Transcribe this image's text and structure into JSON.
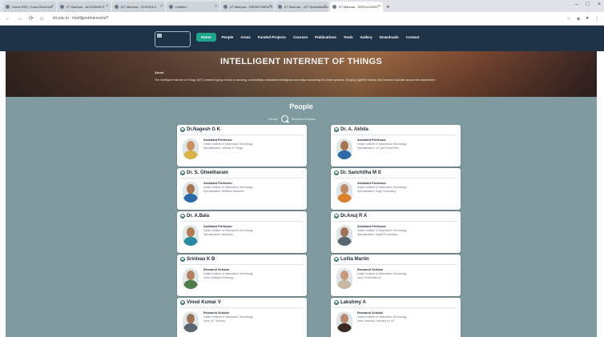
{
  "browser": {
    "tabs": [
      {
        "title": "Home EEE | Sona Electrical",
        "active": false
      },
      {
        "title": "IIT Madurai - ACADEMICS",
        "active": false
      },
      {
        "title": "IIIT Madurai - SCHOOLS",
        "active": false
      },
      {
        "title": "Untitled",
        "active": false
      },
      {
        "title": "IIT Madurai - DEPARTMENTS",
        "active": false
      },
      {
        "title": "IIT Madurai - IOT Specialisation",
        "active": false
      },
      {
        "title": "IIT Madurai - INTELLIGENT",
        "active": true
      }
    ],
    "url": "iiit.edu.in - intelligentInternetIoT",
    "controls": {
      "minimize": "–",
      "maximize": "□",
      "close": "×",
      "newtab": "+"
    },
    "nav": {
      "back": "←",
      "forward": "→",
      "reload": "⟳",
      "home": "⌂"
    }
  },
  "site": {
    "nav_links": [
      "Home",
      "People",
      "Areas",
      "Funded Projects",
      "Courses",
      "Publications",
      "Tools",
      "Gallery",
      "Downloads",
      "Contact"
    ],
    "active_link": "Home"
  },
  "hero": {
    "title": "INTELLIGENT INTERNET OF THINGS",
    "label": "About",
    "text": "The Intelligent Internet of Things (IIoT) research group works on sensing, connectivity, embedded intelligence and edge computing for smart systems, bringing together faculty and research scholars across the department."
  },
  "people": {
    "heading": "People",
    "selector_left": "Faculty",
    "selector_right": "Research Scholars",
    "cards": [
      {
        "name": "Dr.Nagesh G K",
        "role": "Assistant Professor",
        "dept": "Indian Institute of Information Technology",
        "dept2": "Specialization: Internet of Things",
        "photo": "yellow"
      },
      {
        "name": "Dr. A. Akhila",
        "role": "Assistant Professor",
        "dept": "Indian Institute of Information Technology",
        "dept2": "Specialization: IoT and Embedded",
        "photo": "blue"
      },
      {
        "name": "Dr. S. Gheetharam",
        "role": "Assistant Professor",
        "dept": "Indian Institute of Information Technology",
        "dept2": "Specialization: Wireless Networks",
        "photo": "blue"
      },
      {
        "name": "Dr. Sanchitha M S",
        "role": "Assistant Professor",
        "dept": "Indian Institute of Information Technology",
        "dept2": "Specialization: Edge Computing",
        "photo": "orange"
      },
      {
        "name": "Dr. A.Bala",
        "role": "Assistant Professor",
        "dept": "Indian Institute of Information Technology",
        "dept2": "Specialization: Networks",
        "photo": "teal"
      },
      {
        "name": "Dr.Anuj R A",
        "role": "Assistant Professor",
        "dept": "Indian Institute of Information Technology",
        "dept2": "Specialization: Signal Processing",
        "photo": "gray"
      },
      {
        "name": "Srinivas K B",
        "role": "Research Scholar",
        "dept": "Indian Institute of Information Technology",
        "dept2": "Area: Intelligent Sensing",
        "photo": "green"
      },
      {
        "name": "Lolita Martin",
        "role": "Research Scholar",
        "dept": "Indian Institute of Information Technology",
        "dept2": "Area: Embedded AI",
        "photo": "light"
      },
      {
        "name": "Vinod Kumar V",
        "role": "Research Scholar",
        "dept": "Indian Institute of Information Technology",
        "dept2": "Area: IoT Security",
        "photo": "gray"
      },
      {
        "name": "Lakshmy A",
        "role": "Research Scholar",
        "dept": "Indian Institute of Information Technology",
        "dept2": "Area: Machine Learning for IoT",
        "photo": "dark"
      }
    ]
  },
  "colors": {
    "nav_bg": "#1f3346",
    "accent": "#1fa58a",
    "page_bg": "#7f9ba0"
  }
}
